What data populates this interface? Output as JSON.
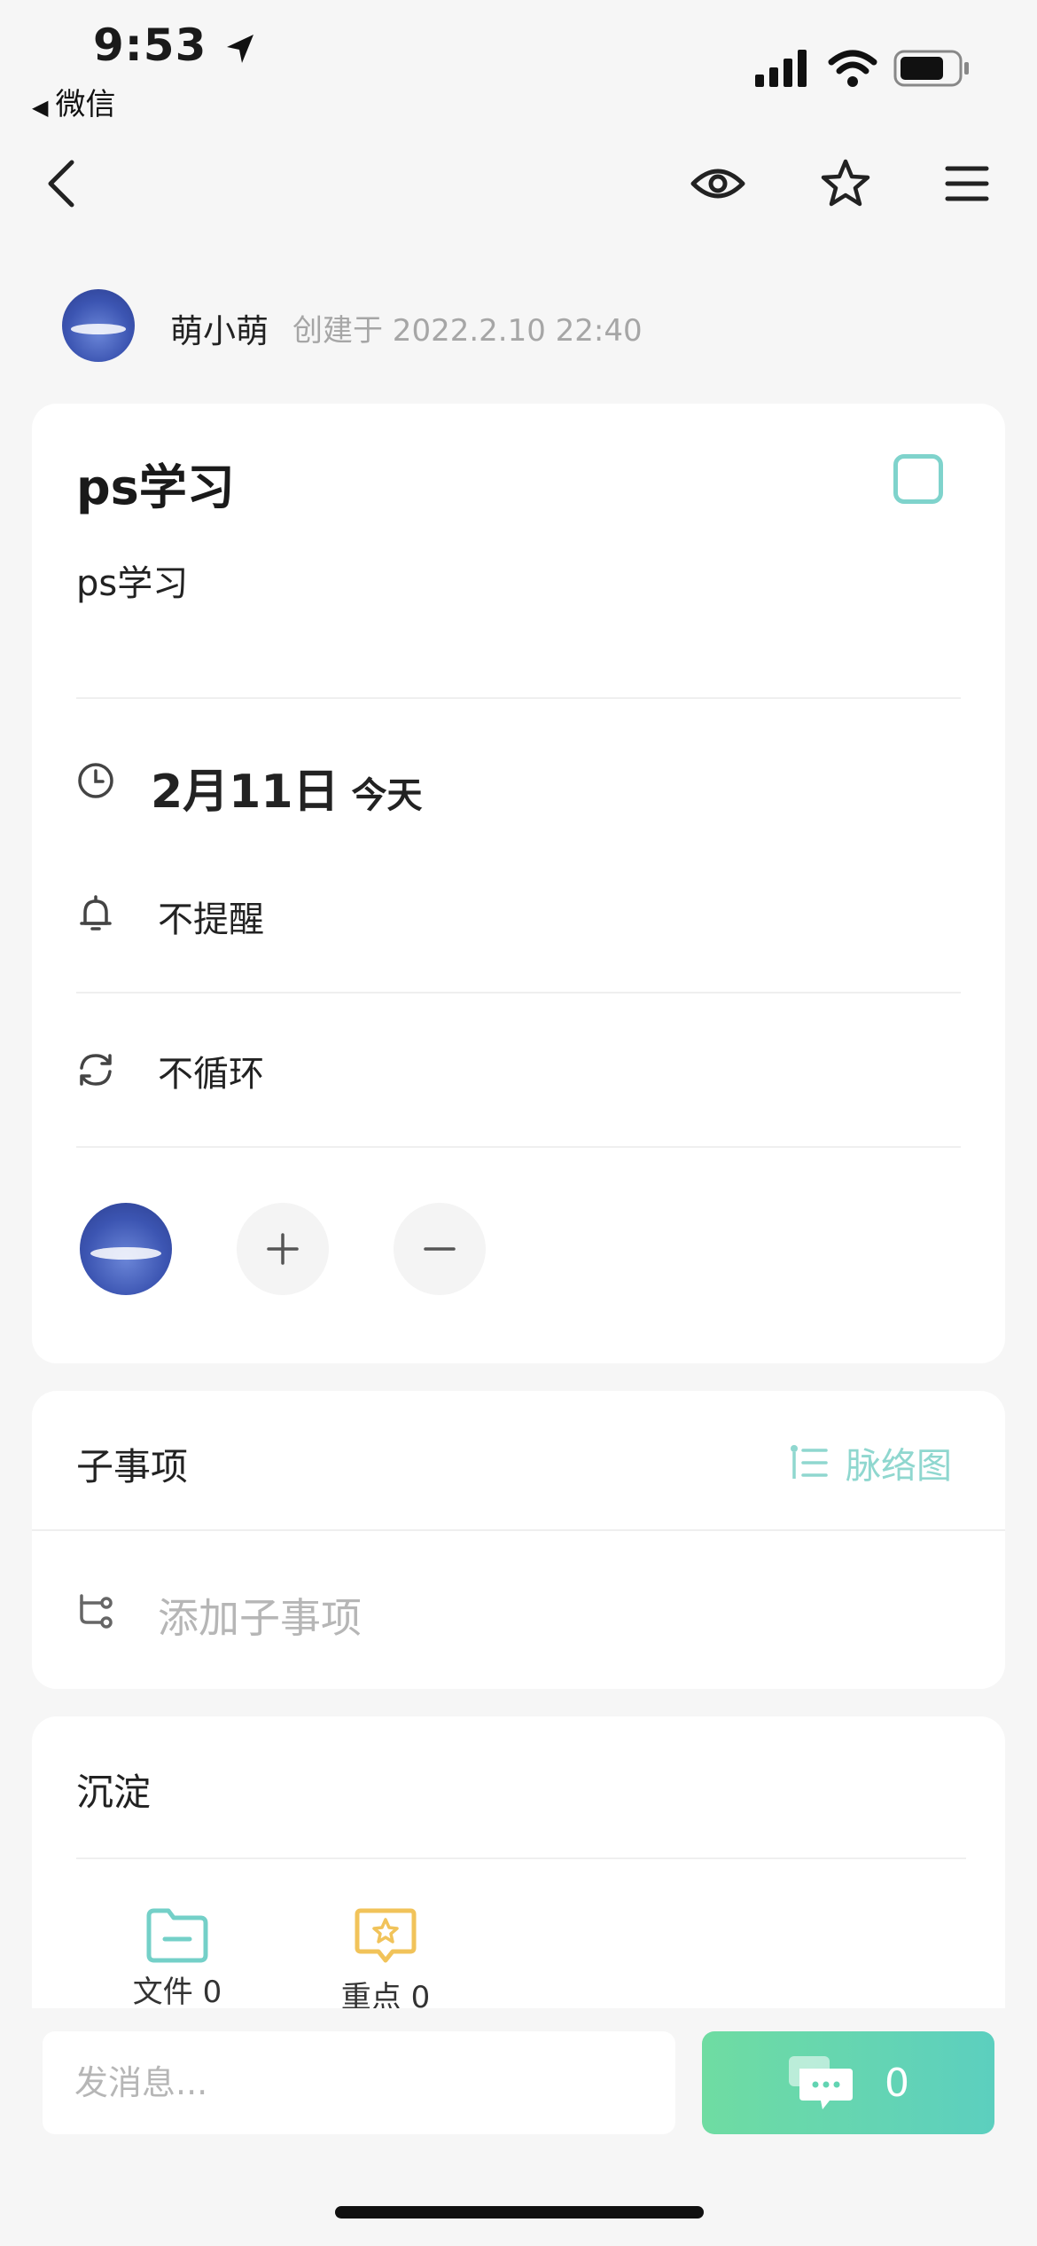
{
  "status_bar": {
    "time": "9:53",
    "back_app_label": "微信"
  },
  "header": {
    "icons": [
      "back-chevron-icon",
      "eye-icon",
      "star-icon",
      "menu-icon"
    ]
  },
  "creator": {
    "name": "萌小萌",
    "meta": "创建于 2022.2.10 22:40"
  },
  "task": {
    "title": "ps学习",
    "description": "ps学习",
    "date": "2月11日",
    "date_relative": "今天",
    "reminder": "不提醒",
    "repeat": "不循环"
  },
  "subtasks": {
    "title": "子事项",
    "mindmap_label": "脉络图",
    "add_placeholder": "添加子事项"
  },
  "deposit": {
    "title": "沉淀",
    "items": [
      {
        "label": "文件 0"
      },
      {
        "label": "重点 0"
      }
    ]
  },
  "footer": {
    "message_placeholder": "发消息...",
    "comment_count": "0"
  },
  "colors": {
    "accent": "#7fd3cc",
    "button_gradient_start": "#6fdca2",
    "button_gradient_end": "#5ccfbf",
    "star_yellow": "#f1c35a"
  }
}
